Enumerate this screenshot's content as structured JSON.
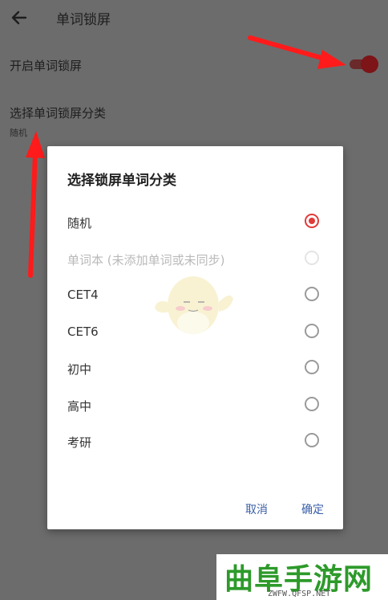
{
  "appbar": {
    "title": "单词锁屏",
    "back_icon": "arrow-left-icon"
  },
  "settings": {
    "enable_label": "开启单词锁屏",
    "category_label": "选择单词锁屏分类",
    "category_value": "随机",
    "toggle_on": true,
    "accent": "#7d1418"
  },
  "dialog": {
    "title": "选择锁屏单词分类",
    "options": [
      {
        "label": "随机",
        "checked": true,
        "disabled": false
      },
      {
        "label": "单词本 (未添加单词或未同步)",
        "checked": false,
        "disabled": true
      },
      {
        "label": "CET4",
        "checked": false,
        "disabled": false
      },
      {
        "label": "CET6",
        "checked": false,
        "disabled": false
      },
      {
        "label": "初中",
        "checked": false,
        "disabled": false
      },
      {
        "label": "高中",
        "checked": false,
        "disabled": false
      },
      {
        "label": "考研",
        "checked": false,
        "disabled": false
      }
    ],
    "cancel_label": "取消",
    "ok_label": "确定",
    "radio_color": "#e23a3a",
    "button_color": "#3b5fa8"
  },
  "watermark": {
    "text": "曲阜手游网",
    "url": "ZWFW.QFSP.NET"
  },
  "annotation": {
    "arrow_color": "#ff1b1b"
  }
}
